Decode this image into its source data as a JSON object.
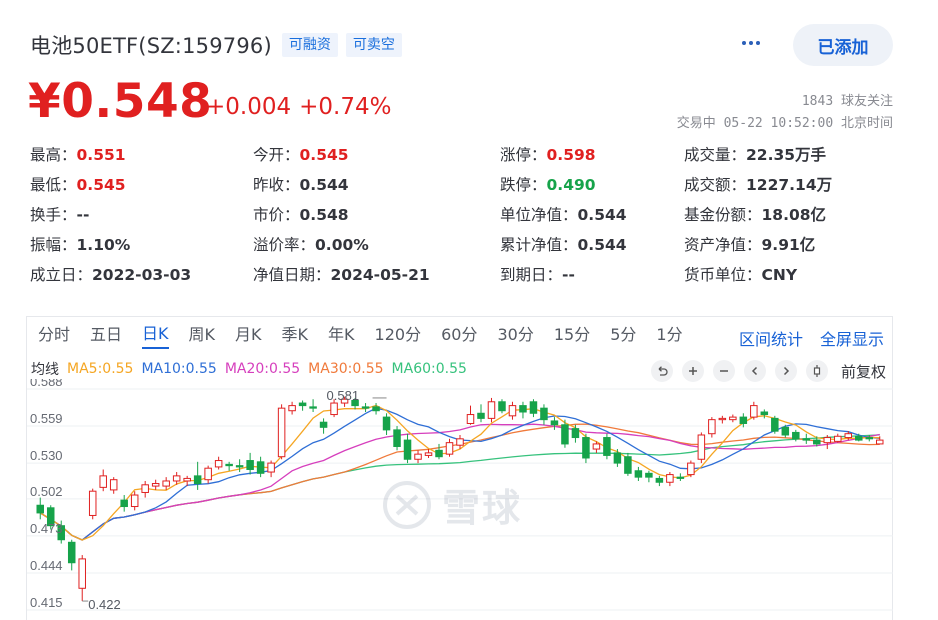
{
  "header": {
    "stock_name": "电池50ETF(SZ:159796)",
    "tags": [
      "可融资",
      "可卖空"
    ],
    "added_label": "已添加"
  },
  "quote": {
    "price": "¥0.548",
    "change": "+0.004",
    "change_pct": "+0.74%",
    "followers": "1843 球友关注",
    "trade_time": "交易中 05-22 10:52:00 北京时间"
  },
  "stats": [
    [
      {
        "label": "最高：",
        "value": "0.551",
        "color": "red"
      },
      {
        "label": "今开：",
        "value": "0.545",
        "color": "red"
      },
      {
        "label": "涨停：",
        "value": "0.598",
        "color": "red"
      },
      {
        "label": "成交量：",
        "value": "22.35万手",
        "color": ""
      }
    ],
    [
      {
        "label": "最低：",
        "value": "0.545",
        "color": "red"
      },
      {
        "label": "昨收：",
        "value": "0.544",
        "color": ""
      },
      {
        "label": "跌停：",
        "value": "0.490",
        "color": "green"
      },
      {
        "label": "成交额：",
        "value": "1227.14万",
        "color": ""
      }
    ],
    [
      {
        "label": "换手：",
        "value": "--",
        "color": ""
      },
      {
        "label": "市价：",
        "value": "0.548",
        "color": ""
      },
      {
        "label": "单位净值：",
        "value": "0.544",
        "color": ""
      },
      {
        "label": "基金份额：",
        "value": "18.08亿",
        "color": ""
      }
    ],
    [
      {
        "label": "振幅：",
        "value": "1.10%",
        "color": ""
      },
      {
        "label": "溢价率：",
        "value": "0.00%",
        "color": ""
      },
      {
        "label": "累计净值：",
        "value": "0.544",
        "color": ""
      },
      {
        "label": "资产净值：",
        "value": "9.91亿",
        "color": ""
      }
    ],
    [
      {
        "label": "成立日：",
        "value": "2022-03-03",
        "color": ""
      },
      {
        "label": "净值日期：",
        "value": "2024-05-21",
        "color": ""
      },
      {
        "label": "到期日：",
        "value": "--",
        "color": ""
      },
      {
        "label": "货币单位：",
        "value": "CNY",
        "color": ""
      }
    ]
  ],
  "chart_panel": {
    "period_tabs": [
      "分时",
      "五日",
      "日K",
      "周K",
      "月K",
      "季K",
      "年K",
      "120分",
      "60分",
      "30分",
      "15分",
      "5分",
      "1分"
    ],
    "active_tab": "日K",
    "interval_stats_label": "区间统计",
    "fullscreen_label": "全屏显示",
    "ma_legend": [
      {
        "text": "均线",
        "color": "#33353c"
      },
      {
        "text": "MA5:0.55",
        "color": "#f5a623"
      },
      {
        "text": "MA10:0.55",
        "color": "#2f6fd6"
      },
      {
        "text": "MA20:0.55",
        "color": "#d63fbd"
      },
      {
        "text": "MA30:0.55",
        "color": "#f07a3b"
      },
      {
        "text": "MA60:0.55",
        "color": "#37c27d"
      }
    ],
    "tool_icons": [
      "undo-icon",
      "zoom-in-icon",
      "zoom-out-icon",
      "prev-icon",
      "next-icon",
      "candle-icon"
    ],
    "adjust_label": "前复权",
    "watermark": "雪球"
  },
  "chart_data": {
    "type": "candlestick",
    "y_ticks": [
      "0.588",
      "0.559",
      "0.530",
      "0.502",
      "0.473",
      "0.444",
      "0.415"
    ],
    "ylim": [
      0.415,
      0.588
    ],
    "annotations": [
      {
        "label": "0.581",
        "value": 0.581,
        "index": 33
      },
      {
        "label": "0.422",
        "value": 0.422,
        "index": 4
      }
    ],
    "up_color": "#e02020",
    "down_color": "#16a34a",
    "candles": [
      [
        0.497,
        0.491,
        0.503,
        0.486
      ],
      [
        0.495,
        0.481,
        0.497,
        0.478
      ],
      [
        0.481,
        0.47,
        0.485,
        0.467
      ],
      [
        0.468,
        0.452,
        0.47,
        0.446
      ],
      [
        0.432,
        0.455,
        0.458,
        0.422
      ],
      [
        0.489,
        0.508,
        0.51,
        0.486
      ],
      [
        0.511,
        0.52,
        0.525,
        0.508
      ],
      [
        0.509,
        0.517,
        0.519,
        0.506
      ],
      [
        0.501,
        0.496,
        0.505,
        0.492
      ],
      [
        0.496,
        0.505,
        0.508,
        0.493
      ],
      [
        0.507,
        0.513,
        0.516,
        0.503
      ],
      [
        0.512,
        0.514,
        0.517,
        0.509
      ],
      [
        0.512,
        0.516,
        0.519,
        0.509
      ],
      [
        0.516,
        0.52,
        0.523,
        0.513
      ],
      [
        0.516,
        0.518,
        0.52,
        0.512
      ],
      [
        0.52,
        0.514,
        0.531,
        0.509
      ],
      [
        0.517,
        0.526,
        0.528,
        0.514
      ],
      [
        0.527,
        0.532,
        0.535,
        0.525
      ],
      [
        0.529,
        0.528,
        0.531,
        0.524
      ],
      [
        0.528,
        0.527,
        0.533,
        0.523
      ],
      [
        0.532,
        0.525,
        0.538,
        0.521
      ],
      [
        0.531,
        0.522,
        0.535,
        0.519
      ],
      [
        0.523,
        0.53,
        0.532,
        0.519
      ],
      [
        0.535,
        0.573,
        0.576,
        0.533
      ],
      [
        0.571,
        0.575,
        0.578,
        0.568
      ],
      [
        0.577,
        0.575,
        0.579,
        0.571
      ],
      [
        0.574,
        0.573,
        0.58,
        0.57
      ],
      [
        0.562,
        0.558,
        0.565,
        0.553
      ],
      [
        0.568,
        0.577,
        0.58,
        0.566
      ],
      [
        0.577,
        0.58,
        0.582,
        0.574
      ],
      [
        0.579,
        0.575,
        0.581,
        0.572
      ],
      [
        0.574,
        0.573,
        0.577,
        0.57
      ],
      [
        0.574,
        0.571,
        0.577,
        0.568
      ],
      [
        0.566,
        0.556,
        0.569,
        0.552
      ],
      [
        0.556,
        0.543,
        0.559,
        0.54
      ],
      [
        0.548,
        0.533,
        0.553,
        0.53
      ],
      [
        0.533,
        0.537,
        0.54,
        0.53
      ],
      [
        0.536,
        0.538,
        0.541,
        0.534
      ],
      [
        0.54,
        0.535,
        0.545,
        0.533
      ],
      [
        0.537,
        0.546,
        0.549,
        0.535
      ],
      [
        0.544,
        0.549,
        0.552,
        0.541
      ],
      [
        0.561,
        0.568,
        0.575,
        0.56
      ],
      [
        0.569,
        0.565,
        0.576,
        0.562
      ],
      [
        0.565,
        0.578,
        0.581,
        0.562
      ],
      [
        0.578,
        0.571,
        0.58,
        0.569
      ],
      [
        0.567,
        0.575,
        0.578,
        0.564
      ],
      [
        0.575,
        0.57,
        0.578,
        0.565
      ],
      [
        0.578,
        0.569,
        0.58,
        0.566
      ],
      [
        0.573,
        0.564,
        0.576,
        0.56
      ],
      [
        0.563,
        0.56,
        0.566,
        0.556
      ],
      [
        0.56,
        0.545,
        0.564,
        0.542
      ],
      [
        0.557,
        0.55,
        0.56,
        0.546
      ],
      [
        0.55,
        0.534,
        0.553,
        0.53
      ],
      [
        0.541,
        0.545,
        0.547,
        0.538
      ],
      [
        0.55,
        0.536,
        0.553,
        0.533
      ],
      [
        0.538,
        0.53,
        0.541,
        0.527
      ],
      [
        0.535,
        0.522,
        0.538,
        0.52
      ],
      [
        0.524,
        0.519,
        0.527,
        0.516
      ],
      [
        0.522,
        0.519,
        0.524,
        0.515
      ],
      [
        0.518,
        0.515,
        0.52,
        0.512
      ],
      [
        0.515,
        0.521,
        0.523,
        0.512
      ],
      [
        0.519,
        0.518,
        0.522,
        0.516
      ],
      [
        0.521,
        0.53,
        0.532,
        0.519
      ],
      [
        0.533,
        0.552,
        0.554,
        0.53
      ],
      [
        0.553,
        0.564,
        0.566,
        0.55
      ],
      [
        0.564,
        0.565,
        0.567,
        0.561
      ],
      [
        0.564,
        0.566,
        0.568,
        0.562
      ],
      [
        0.566,
        0.561,
        0.569,
        0.558
      ],
      [
        0.566,
        0.575,
        0.578,
        0.564
      ],
      [
        0.57,
        0.568,
        0.572,
        0.565
      ],
      [
        0.565,
        0.555,
        0.567,
        0.553
      ],
      [
        0.558,
        0.552,
        0.56,
        0.55
      ],
      [
        0.554,
        0.549,
        0.556,
        0.547
      ],
      [
        0.549,
        0.548,
        0.553,
        0.545
      ],
      [
        0.548,
        0.545,
        0.551,
        0.543
      ],
      [
        0.546,
        0.55,
        0.552,
        0.541
      ],
      [
        0.547,
        0.551,
        0.553,
        0.546
      ],
      [
        0.55,
        0.553,
        0.555,
        0.548
      ],
      [
        0.551,
        0.548,
        0.553,
        0.547
      ],
      [
        0.55,
        0.549,
        0.552,
        0.547
      ],
      [
        0.545,
        0.548,
        0.551,
        0.545
      ]
    ]
  }
}
